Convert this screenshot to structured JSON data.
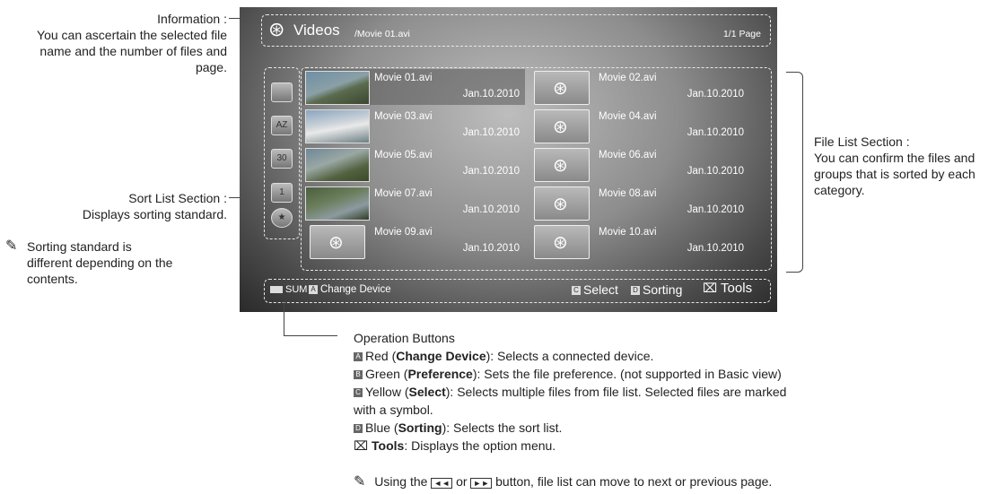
{
  "annotations": {
    "information_title": "Information :",
    "information_desc": [
      "You can ascertain the selected file",
      "name and the number of files and",
      "page."
    ],
    "sort_title": "Sort List Section :",
    "sort_desc": "Displays sorting standard.",
    "sorting_note": [
      "Sorting standard is",
      "different depending on the",
      "contents."
    ],
    "file_list_title": "File List Section :",
    "file_list_desc": [
      "You can confirm the files and",
      "groups that is sorted by each",
      "category."
    ]
  },
  "screen": {
    "title": "Videos",
    "path": "/Movie 01.avi",
    "page": "1/1 Page",
    "sort_icons": [
      {
        "icon": "folder-icon",
        "label": ""
      },
      {
        "icon": "alphabetical-icon",
        "label": "AZ"
      },
      {
        "icon": "calendar-30-icon",
        "label": "30"
      },
      {
        "icon": "calendar-1-icon",
        "label": "1"
      },
      {
        "icon": "star-icon",
        "label": "★"
      }
    ],
    "files": [
      {
        "name": "Movie 01.avi",
        "date": "Jan.10.2010",
        "thumb": "photo"
      },
      {
        "name": "Movie 02.avi",
        "date": "Jan.10.2010",
        "thumb": "icon"
      },
      {
        "name": "Movie 03.avi",
        "date": "Jan.10.2010",
        "thumb": "photo"
      },
      {
        "name": "Movie 04.avi",
        "date": "Jan.10.2010",
        "thumb": "icon"
      },
      {
        "name": "Movie 05.avi",
        "date": "Jan.10.2010",
        "thumb": "photo"
      },
      {
        "name": "Movie 06.avi",
        "date": "Jan.10.2010",
        "thumb": "icon"
      },
      {
        "name": "Movie 07.avi",
        "date": "Jan.10.2010",
        "thumb": "photo"
      },
      {
        "name": "Movie 08.avi",
        "date": "Jan.10.2010",
        "thumb": "icon"
      },
      {
        "name": "Movie 09.avi",
        "date": "Jan.10.2010",
        "thumb": "icon"
      },
      {
        "name": "Movie 10.avi",
        "date": "Jan.10.2010",
        "thumb": "icon"
      }
    ],
    "bottom_bar": {
      "sum": "SUM",
      "key_a": "A",
      "change_device": "Change Device",
      "key_c": "C",
      "select": "Select",
      "key_d": "D",
      "sorting": "Sorting",
      "tools": "Tools"
    }
  },
  "operation": {
    "title": "Operation Buttons",
    "lines": [
      {
        "key": "A",
        "pre": "Red (",
        "bold": "Change Device",
        "post": "): Selects a connected device."
      },
      {
        "key": "B",
        "pre": "Green (",
        "bold": "Preference",
        "post": "): Sets the file preference. (not supported in Basic view)"
      },
      {
        "key": "C",
        "pre": "Yellow (",
        "bold": "Select",
        "post": "): Selects multiple files from file list. Selected files are marked"
      },
      {
        "key": "",
        "pre": "with a symbol.",
        "bold": "",
        "post": ""
      },
      {
        "key": "D",
        "pre": "Blue (",
        "bold": "Sorting",
        "post": "): Selects the sort list."
      },
      {
        "key": "tools",
        "pre": "",
        "bold": "Tools",
        "post": ": Displays the option menu."
      }
    ],
    "note_pre": "Using the",
    "note_rew": "◄◄",
    "note_or": "or",
    "note_ff": "►►",
    "note_post": "button, file list can move to next or previous page."
  }
}
